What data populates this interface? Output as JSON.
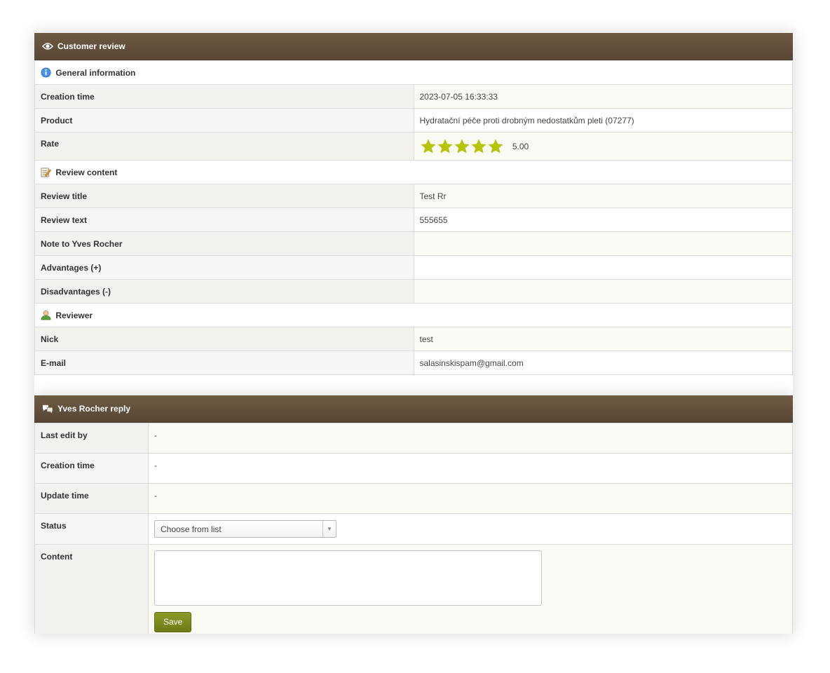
{
  "review_panel": {
    "title": "Customer review",
    "sections": {
      "general": "General information",
      "content": "Review content",
      "reviewer": "Reviewer"
    },
    "rows": {
      "creation_time": {
        "label": "Creation time",
        "value": "2023-07-05 16:33:33"
      },
      "product": {
        "label": "Product",
        "value": "Hydratační péče proti drobným nedostatkům pleti (07277)"
      },
      "rate": {
        "label": "Rate",
        "value": "5.00",
        "stars": 5,
        "max_stars": 5
      },
      "review_title": {
        "label": "Review title",
        "value": "Test Rr"
      },
      "review_text": {
        "label": "Review text",
        "value": "555655"
      },
      "note": {
        "label": "Note to Yves Rocher",
        "value": ""
      },
      "advantages": {
        "label": "Advantages (+)",
        "value": ""
      },
      "disadvantages": {
        "label": "Disadvantages (-)",
        "value": ""
      },
      "nick": {
        "label": "Nick",
        "value": "test"
      },
      "email": {
        "label": "E-mail",
        "value": "salasinskispam@gmail.com"
      }
    }
  },
  "reply_panel": {
    "title": "Yves Rocher reply",
    "rows": {
      "last_edit_by": {
        "label": "Last edit by",
        "value": "-"
      },
      "creation_time": {
        "label": "Creation time",
        "value": "-"
      },
      "update_time": {
        "label": "Update time",
        "value": "-"
      },
      "status": {
        "label": "Status",
        "selected": "Choose from list"
      },
      "content": {
        "label": "Content",
        "value": ""
      }
    },
    "save_label": "Save"
  },
  "colors": {
    "header": "#5f4e3a",
    "star": "#b6c40a",
    "save_button": "#7f8a1e"
  },
  "icons": {
    "review_header": "eye-icon",
    "general": "info-icon",
    "content": "notepad-pencil-icon",
    "reviewer": "user-icon",
    "reply_header": "chat-bubbles-icon"
  }
}
